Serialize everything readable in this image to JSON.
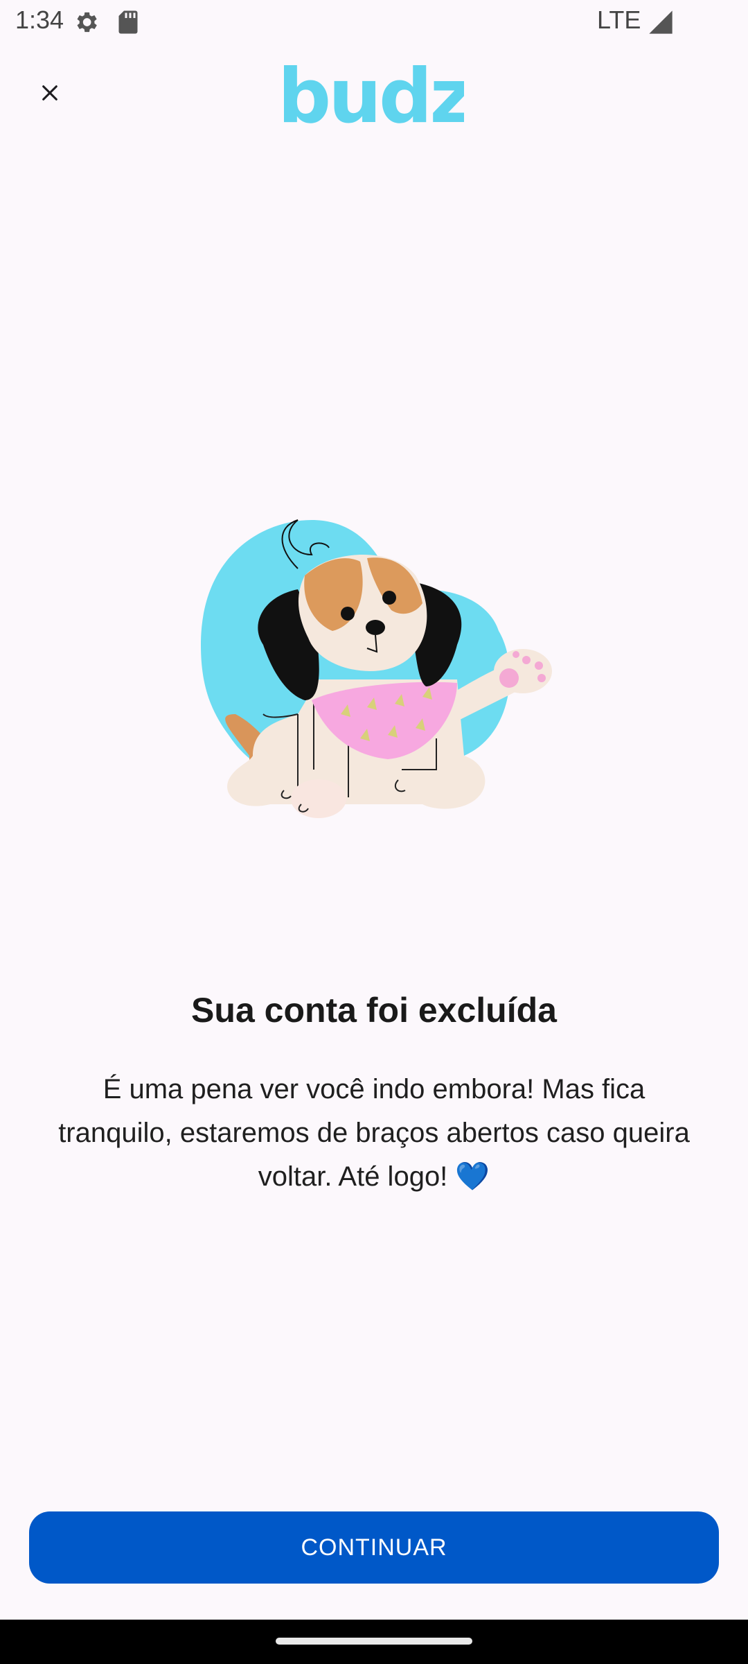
{
  "status_bar": {
    "time": "1:34",
    "network": "LTE",
    "icons": [
      "settings-gear-icon",
      "sd-card-icon",
      "signal-icon"
    ]
  },
  "app_bar": {
    "close_icon": "close-icon",
    "logo_text": "budz",
    "logo_color": "#5fd4ee"
  },
  "illustration": {
    "description_icon": "dog-waving-illustration",
    "blob_color": "#6ddcf1"
  },
  "content": {
    "title": "Sua conta foi excluída",
    "message": "É uma pena ver você indo embora! Mas fica tranquilo, estaremos de braços abertos caso queira voltar. Até logo! 💙"
  },
  "actions": {
    "continue_label": "CONTINUAR",
    "continue_color": "#0058c8"
  }
}
